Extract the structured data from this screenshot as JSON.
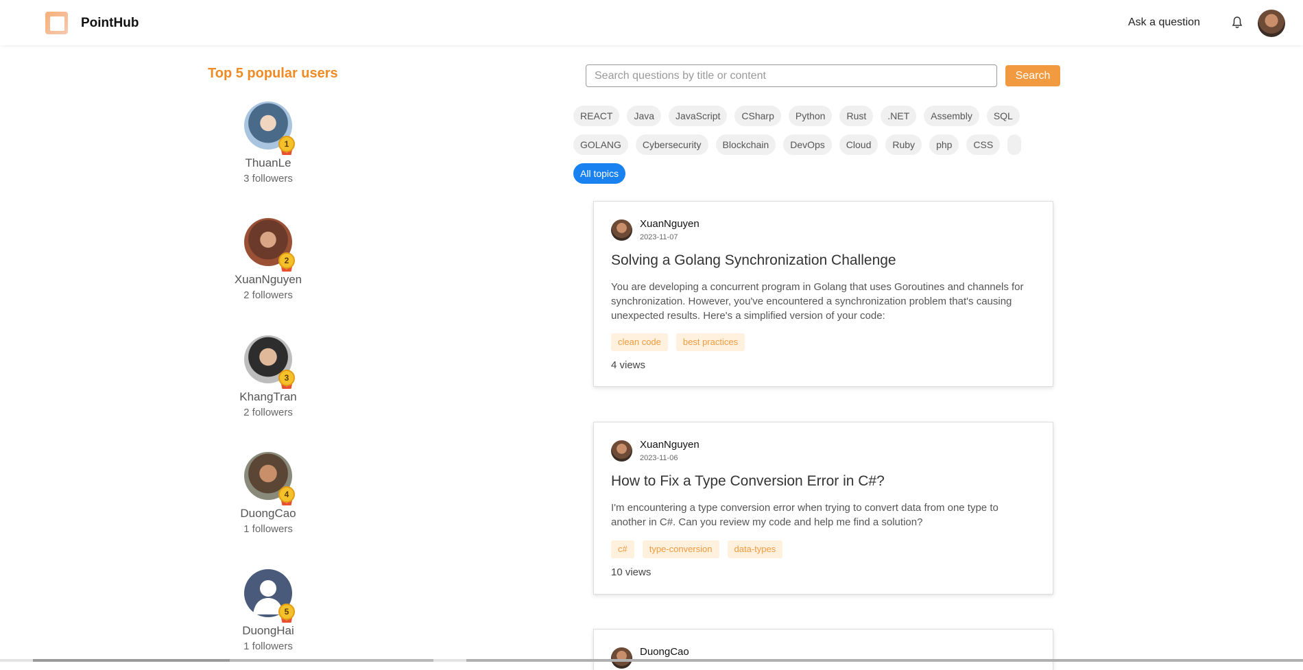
{
  "header": {
    "brand": "PointHub",
    "ask_label": "Ask a question"
  },
  "sidebar": {
    "title": "Top 5 popular users",
    "users": [
      {
        "rank": "1",
        "name": "ThuanLe",
        "followers": "3 followers"
      },
      {
        "rank": "2",
        "name": "XuanNguyen",
        "followers": "2 followers"
      },
      {
        "rank": "3",
        "name": "KhangTran",
        "followers": "2 followers"
      },
      {
        "rank": "4",
        "name": "DuongCao",
        "followers": "1 followers"
      },
      {
        "rank": "5",
        "name": "DuongHai",
        "followers": "1 followers"
      }
    ]
  },
  "search": {
    "placeholder": "Search questions by title or content",
    "button_label": "Search"
  },
  "topics": {
    "row1": [
      "REACT",
      "Java",
      "JavaScript",
      "CSharp",
      "Python",
      "Rust",
      ".NET",
      "Assembly",
      "SQL"
    ],
    "row2": [
      "GOLANG",
      "Cybersecurity",
      "Blockchain",
      "DevOps",
      "Cloud",
      "Ruby",
      "php",
      "CSS"
    ],
    "all_label": "All topics"
  },
  "posts": [
    {
      "author": "XuanNguyen",
      "date": "2023-11-07",
      "title": "Solving a Golang Synchronization Challenge",
      "body": "You are developing a concurrent program in Golang that uses Goroutines and channels for synchronization. However, you've encountered a synchronization problem that's causing unexpected results. Here's a simplified version of your code:",
      "tags": [
        "clean code",
        "best practices"
      ],
      "views": "4 views"
    },
    {
      "author": "XuanNguyen",
      "date": "2023-11-06",
      "title": "How to Fix a Type Conversion Error in C#?",
      "body": "I'm encountering a type conversion error when trying to convert data from one type to another in C#. Can you review my code and help me find a solution?",
      "tags": [
        "c#",
        "type-conversion",
        "data-types"
      ],
      "views": "10 views"
    },
    {
      "author": "DuongCao"
    }
  ]
}
